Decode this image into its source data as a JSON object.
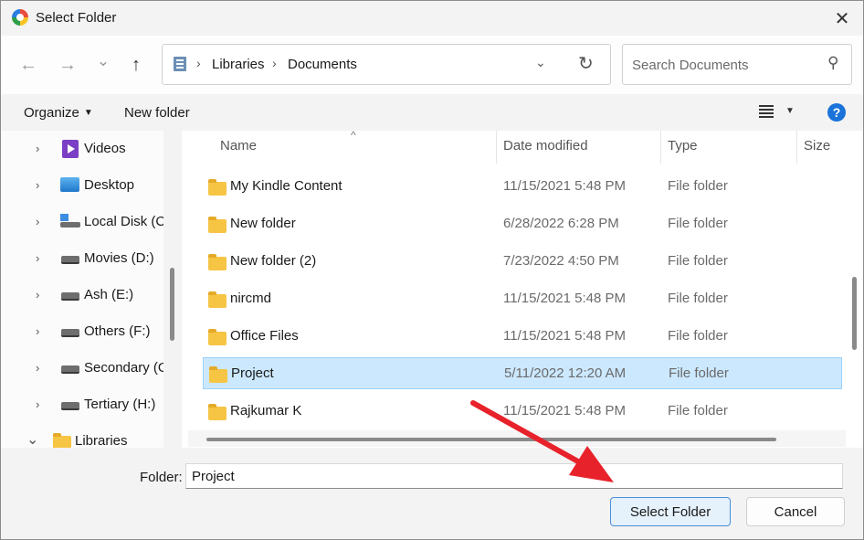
{
  "window": {
    "title": "Select Folder",
    "close_glyph": "✕"
  },
  "nav": {
    "back_glyph": "←",
    "forward_glyph": "→",
    "recent_glyph": "⌄",
    "up_glyph": "↑",
    "breadcrumbs": [
      "Libraries",
      "Documents"
    ],
    "crumb_sep": "›",
    "dropdown_glyph": "⌄",
    "refresh_glyph": "↻",
    "search_placeholder": "Search Documents",
    "search_glyph": "⚲"
  },
  "toolbar": {
    "organize_label": "Organize",
    "new_folder_label": "New folder",
    "help_glyph": "?"
  },
  "sidebar": {
    "items": [
      {
        "label": "Videos",
        "icon": "videos-icon",
        "chevron": "›"
      },
      {
        "label": "Desktop",
        "icon": "desktop-icon",
        "chevron": "›"
      },
      {
        "label": "Local Disk (C",
        "icon": "local-disk-icon",
        "chevron": "›"
      },
      {
        "label": "Movies (D:)",
        "icon": "drive-icon",
        "chevron": "›"
      },
      {
        "label": "Ash (E:)",
        "icon": "drive-icon",
        "chevron": "›"
      },
      {
        "label": "Others (F:)",
        "icon": "drive-icon",
        "chevron": "›"
      },
      {
        "label": "Secondary (G",
        "icon": "drive-icon",
        "chevron": "›"
      },
      {
        "label": "Tertiary (H:)",
        "icon": "drive-icon",
        "chevron": "›"
      },
      {
        "label": "Libraries",
        "icon": "folder-icon",
        "chevron": "⌄"
      }
    ]
  },
  "files": {
    "columns": {
      "name": "Name",
      "date": "Date modified",
      "type": "Type",
      "size": "Size"
    },
    "sort_glyph": "^",
    "rows": [
      {
        "name": "My Kindle Content",
        "date": "11/15/2021 5:48 PM",
        "type": "File folder",
        "selected": false
      },
      {
        "name": "New folder",
        "date": "6/28/2022 6:28 PM",
        "type": "File folder",
        "selected": false
      },
      {
        "name": "New folder (2)",
        "date": "7/23/2022 4:50 PM",
        "type": "File folder",
        "selected": false
      },
      {
        "name": "nircmd",
        "date": "11/15/2021 5:48 PM",
        "type": "File folder",
        "selected": false
      },
      {
        "name": "Office Files",
        "date": "11/15/2021 5:48 PM",
        "type": "File folder",
        "selected": false
      },
      {
        "name": "Project",
        "date": "5/11/2022 12:20 AM",
        "type": "File folder",
        "selected": true
      },
      {
        "name": "Rajkumar K",
        "date": "11/15/2021 5:48 PM",
        "type": "File folder",
        "selected": false
      }
    ]
  },
  "footer": {
    "folder_label": "Folder:",
    "folder_value": "Project",
    "select_button": "Select Folder",
    "cancel_button": "Cancel"
  },
  "colors": {
    "accent": "#1a73d9",
    "selection": "#cce8ff",
    "annotation_arrow": "#e8222a"
  }
}
